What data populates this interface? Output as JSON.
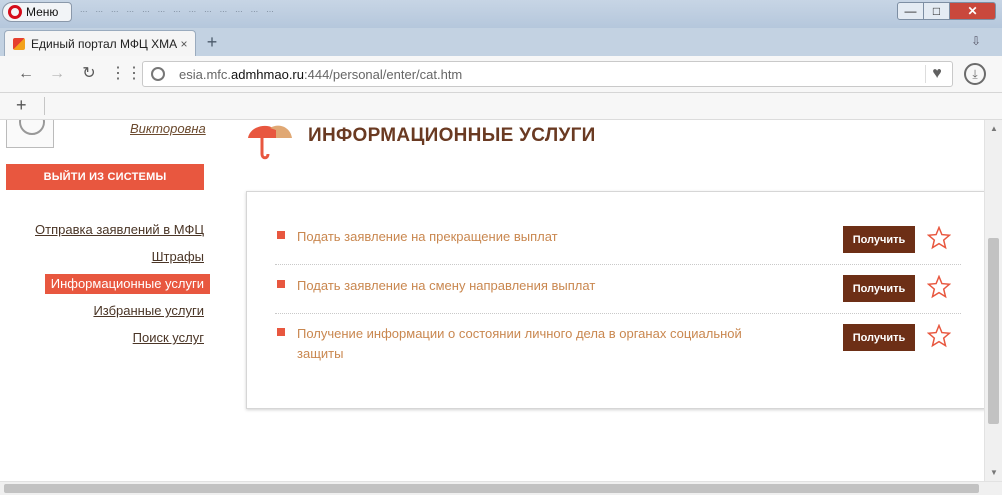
{
  "browser": {
    "menu_label": "Меню",
    "speed_dial": [
      "...",
      "...",
      "...",
      "...",
      "...",
      "...",
      "...",
      "...",
      "...",
      "...",
      "...",
      "...",
      "..."
    ],
    "window_controls": {
      "minimize": "—",
      "maximize": "□",
      "close": "✕"
    },
    "tab": {
      "title": "Единый портал МФЦ ХМА",
      "close": "×"
    },
    "new_tab": "+",
    "tab_menu": "⇩",
    "nav": {
      "back": "←",
      "forward": "→",
      "reload": "↻",
      "grid": "⋮⋮"
    },
    "url": {
      "prefix": "esia.mfc.",
      "domain": "admhmao.ru",
      "rest": ":444/personal/enter/cat.htm"
    },
    "heart": "♥",
    "download": "⤓",
    "bookmarks_plus": "+"
  },
  "sidebar": {
    "username": "Викторовна",
    "logout": "ВЫЙТИ ИЗ СИСТЕМЫ",
    "items": [
      {
        "label": "Отправка заявлений в МФЦ",
        "active": false
      },
      {
        "label": "Штрафы",
        "active": false
      },
      {
        "label": "Информационные услуги",
        "active": true
      },
      {
        "label": "Избранные услуги",
        "active": false
      },
      {
        "label": "Поиск услуг",
        "active": false
      }
    ]
  },
  "section": {
    "title": "ИНФОРМАЦИОННЫЕ УСЛУГИ",
    "icon": "umbrella-icon"
  },
  "services": [
    {
      "title": "Подать заявление на прекращение выплат",
      "button": "Получить"
    },
    {
      "title": "Подать заявление на смену направления выплат",
      "button": "Получить"
    },
    {
      "title": "Получение информации о состоянии личного дела в органах социальной защиты",
      "button": "Получить"
    }
  ],
  "colors": {
    "accent": "#e8573f",
    "button_dark": "#6d2f16",
    "service_text": "#c9874f",
    "title_brown": "#6a3a22"
  }
}
